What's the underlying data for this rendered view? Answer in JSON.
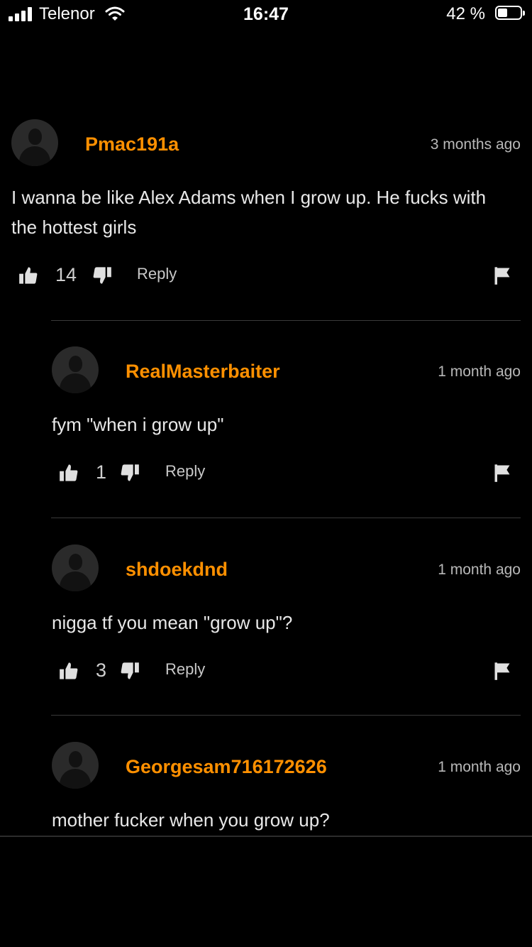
{
  "status_bar": {
    "carrier": "Telenor",
    "time": "16:47",
    "battery_percent": "42 %",
    "battery_level": 0.42,
    "icons": [
      "signal-bars-icon",
      "wifi-icon",
      "battery-icon"
    ]
  },
  "colors": {
    "background": "#000000",
    "username": "#ff9000",
    "text": "#e8e8e8",
    "muted": "#b8b8b8"
  },
  "comments": [
    {
      "username": "Pmac191a",
      "timestamp": "3 months ago",
      "text": "I wanna be like Alex Adams when I grow up. He fucks with the hottest girls",
      "votes": "14",
      "reply_label": "Reply"
    },
    {
      "username": "RealMasterbaiter",
      "timestamp": "1 month ago",
      "text": "fym \"when i grow up\"",
      "votes": "1",
      "reply_label": "Reply"
    },
    {
      "username": "shdoekdnd",
      "timestamp": "1 month ago",
      "text": "nigga tf you mean \"grow up\"?",
      "votes": "3",
      "reply_label": "Reply"
    },
    {
      "username": "Georgesam716172626",
      "timestamp": "1 month ago",
      "text": "mother fucker when you grow up?"
    }
  ]
}
